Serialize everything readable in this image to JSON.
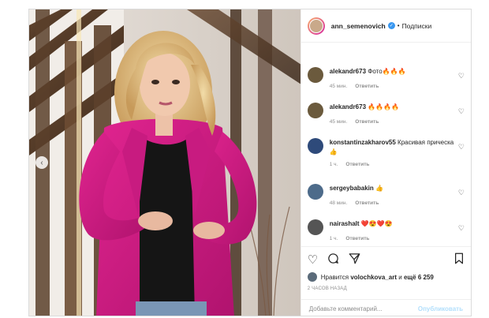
{
  "post": {
    "username": "ann_semenovich",
    "separator": "•",
    "follow_label": "Подписки",
    "verified_glyph": "✓"
  },
  "comments": [
    {
      "user": "alekandr673",
      "text": "Фото🔥🔥🔥",
      "time": "45 мин.",
      "reply": "Ответить",
      "avatar_color": "#6b5a3d"
    },
    {
      "user": "alekandr673",
      "text": "🔥🔥🔥🔥",
      "time": "45 мин.",
      "reply": "Ответить",
      "avatar_color": "#6b5a3d"
    },
    {
      "user": "konstantinzakharov55",
      "text": "Красивая прическа👍",
      "time": "1 ч.",
      "reply": "Ответить",
      "avatar_color": "#2e4a7a"
    },
    {
      "user": "sergeybabakin",
      "text": "👍",
      "time": "48 мин.",
      "reply": "Ответить",
      "avatar_color": "#4d6b8a"
    },
    {
      "user": "nairashalt",
      "text": "❤️😍❤️😍",
      "time": "1 ч.",
      "reply": "Ответить",
      "avatar_color": "#555555"
    }
  ],
  "actions": {
    "likes_prefix": "Нравится",
    "likes_user": "volochkova_art",
    "likes_and": "и",
    "likes_rest": "ещё 6 259",
    "time_ago": "2 ЧАСОВ НАЗАД"
  },
  "add_comment": {
    "placeholder": "Добавьте комментарий...",
    "publish_label": "Опубликовать"
  },
  "icons": [
    "chevron-left-icon",
    "heart-icon",
    "comment-icon",
    "share-icon",
    "bookmark-icon",
    "verified-icon"
  ]
}
